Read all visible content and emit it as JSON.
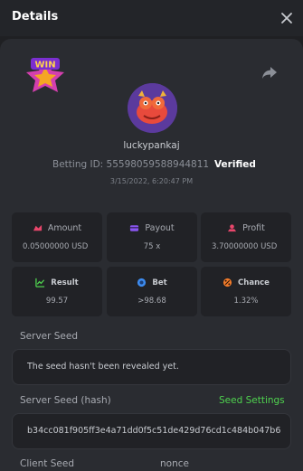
{
  "header": {
    "title": "Details"
  },
  "player": {
    "username": "luckypankaj",
    "betting_id": "Betting ID: 55598059588944811",
    "verified": "Verified",
    "timestamp": "3/15/2022, 6:20:47 PM"
  },
  "stats": {
    "amount": {
      "label": "Amount",
      "value": "0.05000000 USD"
    },
    "payout": {
      "label": "Payout",
      "value": "75 x"
    },
    "profit": {
      "label": "Profit",
      "value": "3.70000000 USD"
    },
    "result": {
      "label": "Result",
      "value": "99.57"
    },
    "bet": {
      "label": "Bet",
      "value": ">98.68"
    },
    "chance": {
      "label": "Chance",
      "value": "1.32%"
    }
  },
  "server_seed": {
    "label": "Server Seed",
    "value": "The seed hasn't been revealed yet."
  },
  "server_seed_hash": {
    "label": "Server Seed (hash)",
    "settings_link": "Seed Settings",
    "value": "b34cc081f905ff3e4a71dd0f5c51de429d76cd1c484b047b6"
  },
  "client_seed": {
    "label": "Client Seed",
    "nonce_label": "nonce"
  },
  "colors": {
    "accent_green": "#4fd24f",
    "badge_win": "#d43fae",
    "avatar_bg": "#5b3a9d"
  },
  "icons": {
    "close": "close-icon",
    "share": "share-icon",
    "win": "win-badge-icon",
    "amount": "amount-icon",
    "payout": "payout-icon",
    "profit": "profit-icon",
    "result": "result-icon",
    "bet": "bet-icon",
    "chance": "chance-icon"
  }
}
